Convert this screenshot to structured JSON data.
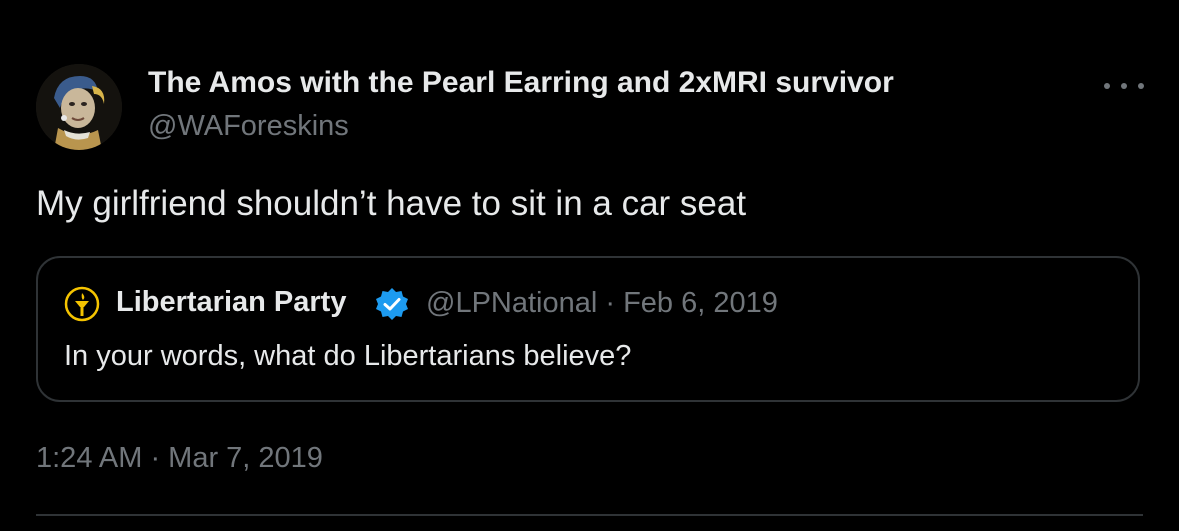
{
  "colors": {
    "background": "#000000",
    "primary_text": "#e7e9ea",
    "secondary_text": "#71767b",
    "border": "#2f3336",
    "verified_badge": "#1d9bf0",
    "libertarian_gold": "#f5c400"
  },
  "author": {
    "display_name": "The Amos with the Pearl Earring and 2xMRI survivor",
    "handle": "@WAForeskins",
    "avatar_icon": "pearl-earring-portrait-avatar"
  },
  "more_icon": "more-options-icon",
  "tweet": {
    "text": "My girlfriend shouldn’t have to sit in a car seat",
    "timestamp": "1:24 AM · Mar 7, 2019"
  },
  "quoted_tweet": {
    "display_name": "Libertarian Party",
    "verified_icon": "verified-badge-icon",
    "avatar_icon": "torch-logo-icon",
    "meta": "@LPNational · Feb 6, 2019",
    "text": "In your words, what do Libertarians believe?"
  }
}
